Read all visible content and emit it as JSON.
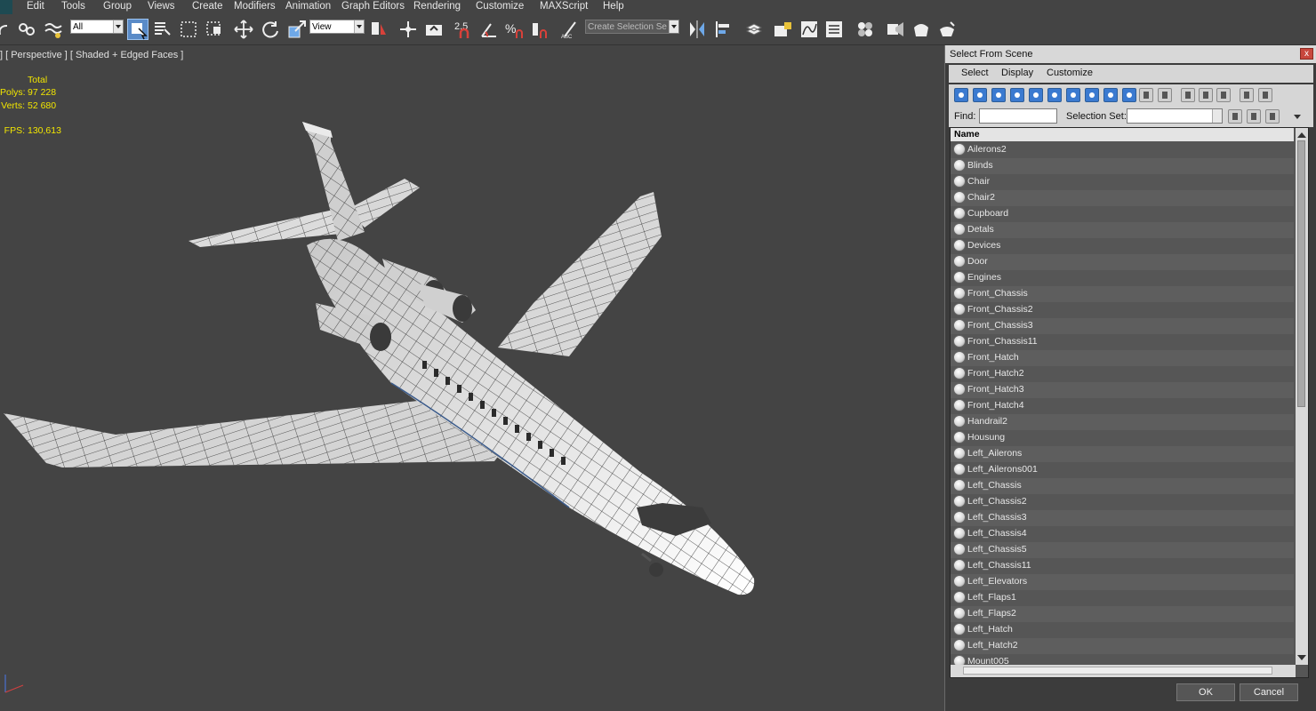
{
  "menu": [
    "Edit",
    "Tools",
    "Group",
    "Views",
    "Create",
    "Modifiers",
    "Animation",
    "Graph Editors",
    "Rendering",
    "Customize",
    "MAXScript",
    "Help"
  ],
  "toolbar": {
    "filter_value": "All",
    "refcoord_value": "View",
    "selection_set_placeholder": "Create Selection Se",
    "snap_label": "2.5"
  },
  "viewport": {
    "label": "] [ Perspective ] [ Shaded + Edged Faces ]",
    "stats": {
      "header": "Total",
      "polys_label": "Polys:",
      "polys_value": "97 228",
      "verts_label": "Verts:",
      "verts_value": "52 680",
      "fps_label": "FPS:",
      "fps_value": "130,613"
    }
  },
  "dialog": {
    "title": "Select From Scene",
    "close_glyph": "x",
    "menu": [
      "Select",
      "Display",
      "Customize"
    ],
    "find_label": "Find:",
    "find_value": "",
    "selection_set_label": "Selection Set:",
    "selection_set_value": "",
    "column_header": "Name",
    "items": [
      "Ailerons2",
      "Blinds",
      "Chair",
      "Chair2",
      "Cupboard",
      "Detals",
      "Devices",
      "Door",
      "Engines",
      "Front_Chassis",
      "Front_Chassis2",
      "Front_Chassis3",
      "Front_Chassis11",
      "Front_Hatch",
      "Front_Hatch2",
      "Front_Hatch3",
      "Front_Hatch4",
      "Handrail2",
      "Housung",
      "Left_Ailerons",
      "Left_Ailerons001",
      "Left_Chassis",
      "Left_Chassis2",
      "Left_Chassis3",
      "Left_Chassis4",
      "Left_Chassis5",
      "Left_Chassis11",
      "Left_Elevators",
      "Left_Flaps1",
      "Left_Flaps2",
      "Left_Hatch",
      "Left_Hatch2",
      "Mount005"
    ],
    "ok_label": "OK",
    "cancel_label": "Cancel"
  },
  "colors": {
    "background": "#444444",
    "stats_text": "#f2e600",
    "selected_tool": "#5a8bc8"
  }
}
